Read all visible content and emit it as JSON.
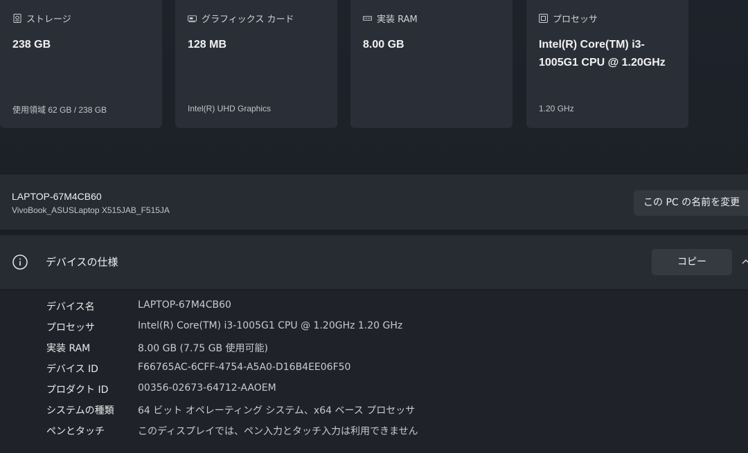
{
  "cards": [
    {
      "icon": "storage-icon",
      "title": "ストレージ",
      "value": "238 GB",
      "sub": "使用領域 62 GB / 238 GB"
    },
    {
      "icon": "graphics-card-icon",
      "title": "グラフィックス カード",
      "value": "128 MB",
      "sub": "Intel(R) UHD Graphics"
    },
    {
      "icon": "ram-icon",
      "title": "実装 RAM",
      "value": "8.00 GB",
      "sub": ""
    },
    {
      "icon": "processor-icon",
      "title": "プロセッサ",
      "value": "Intel(R) Core(TM) i3-1005G1 CPU @ 1.20GHz",
      "sub": "1.20 GHz"
    }
  ],
  "pc": {
    "name": "LAPTOP-67M4CB60",
    "model": "VivoBook_ASUSLaptop X515JAB_F515JA",
    "rename_label": "この PC の名前を変更"
  },
  "spec": {
    "title": "デバイスの仕様",
    "copy_label": "コピー",
    "rows": [
      {
        "label": "デバイス名",
        "value": "LAPTOP-67M4CB60"
      },
      {
        "label": "プロセッサ",
        "value": "Intel(R) Core(TM) i3-1005G1 CPU @ 1.20GHz   1.20 GHz"
      },
      {
        "label": "実装 RAM",
        "value": "8.00 GB (7.75 GB 使用可能)"
      },
      {
        "label": "デバイス ID",
        "value": "F66765AC-6CFF-4754-A5A0-D16B4EE06F50"
      },
      {
        "label": "プロダクト ID",
        "value": "00356-02673-64712-AAOEM"
      },
      {
        "label": "システムの種類",
        "value": "64 ビット オペレーティング システム、x64 ベース プロセッサ"
      },
      {
        "label": "ペンとタッチ",
        "value": "このディスプレイでは、ペン入力とタッチ入力は利用できません"
      }
    ]
  }
}
